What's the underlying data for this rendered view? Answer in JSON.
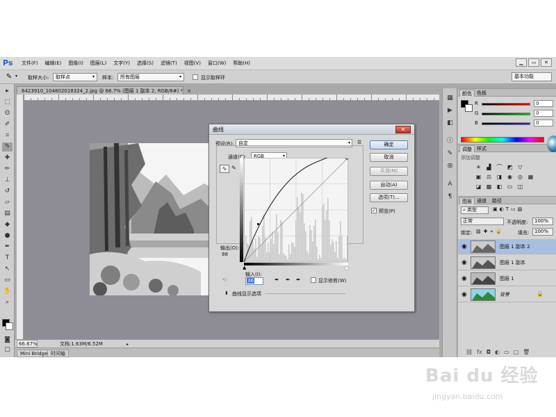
{
  "app": {
    "logo": "Ps",
    "menu": [
      "文件(F)",
      "编辑(E)",
      "图像(I)",
      "图层(L)",
      "文字(Y)",
      "选择(S)",
      "滤镜(T)",
      "视图(V)",
      "窗口(W)",
      "帮助(H)"
    ],
    "window_controls": [
      "▁",
      "▭",
      "✕"
    ]
  },
  "options_bar": {
    "sample_size_label": "取样大小:",
    "sample_size_value": "取样点",
    "sample_label": "样本:",
    "sample_value": "所有图层",
    "show_ring_label": "显示取样环",
    "workspace": "基本功能"
  },
  "document": {
    "tab_title": "6423910_104802018324_2.jpg @ 66.7% (图层 1 副本 2, RGB/8#) *",
    "tab_close": "×",
    "zoom": "66.67%",
    "doc_info": "文档:1.63M/6.52M",
    "bottom_tabs": [
      "Mini Bridge",
      "时间轴"
    ]
  },
  "curves_dialog": {
    "title": "曲线",
    "close": "✕",
    "preset_label": "预设(R):",
    "preset_value": "自定",
    "channel_label": "通道(C):",
    "channel_value": "RGB",
    "output_label": "输出(O):",
    "output_value": "88",
    "input_label": "输入(I):",
    "input_value": "36",
    "show_clipping_label": "显示修剪(W)",
    "curve_options_label": "曲线显示选项",
    "buttons": {
      "ok": "确定",
      "cancel": "取消",
      "smooth": "平滑(M)",
      "auto": "自动(A)",
      "options": "选项(T)..."
    },
    "preview_label": "预览(P)",
    "preview_checked": true
  },
  "color_panel": {
    "tabs": [
      "颜色",
      "色板"
    ],
    "sliders": [
      {
        "label": "R",
        "value": "0",
        "color": "#d41c1c"
      },
      {
        "label": "G",
        "value": "0",
        "color": "#23a021"
      },
      {
        "label": "B",
        "value": "0",
        "color": "#2747d6"
      }
    ]
  },
  "adjustments_panel": {
    "tabs": [
      "调整",
      "样式"
    ],
    "subtitle": "添加调整"
  },
  "layers_panel": {
    "tabs": [
      "图层",
      "通道",
      "路径"
    ],
    "kind_filter": "类型",
    "blend_mode": "正常",
    "opacity_label": "不透明度:",
    "opacity_value": "100%",
    "lock_label": "锁定:",
    "fill_label": "填充:",
    "fill_value": "100%",
    "layers": [
      {
        "name": "图层 1 副本 2",
        "selected": true
      },
      {
        "name": "图层 1 副本",
        "selected": false
      },
      {
        "name": "图层 1",
        "selected": false
      },
      {
        "name": "背景",
        "selected": false,
        "locked": true
      }
    ]
  },
  "watermark": {
    "text": "Bai du 经验",
    "url": "jingyan.baidu.com"
  }
}
